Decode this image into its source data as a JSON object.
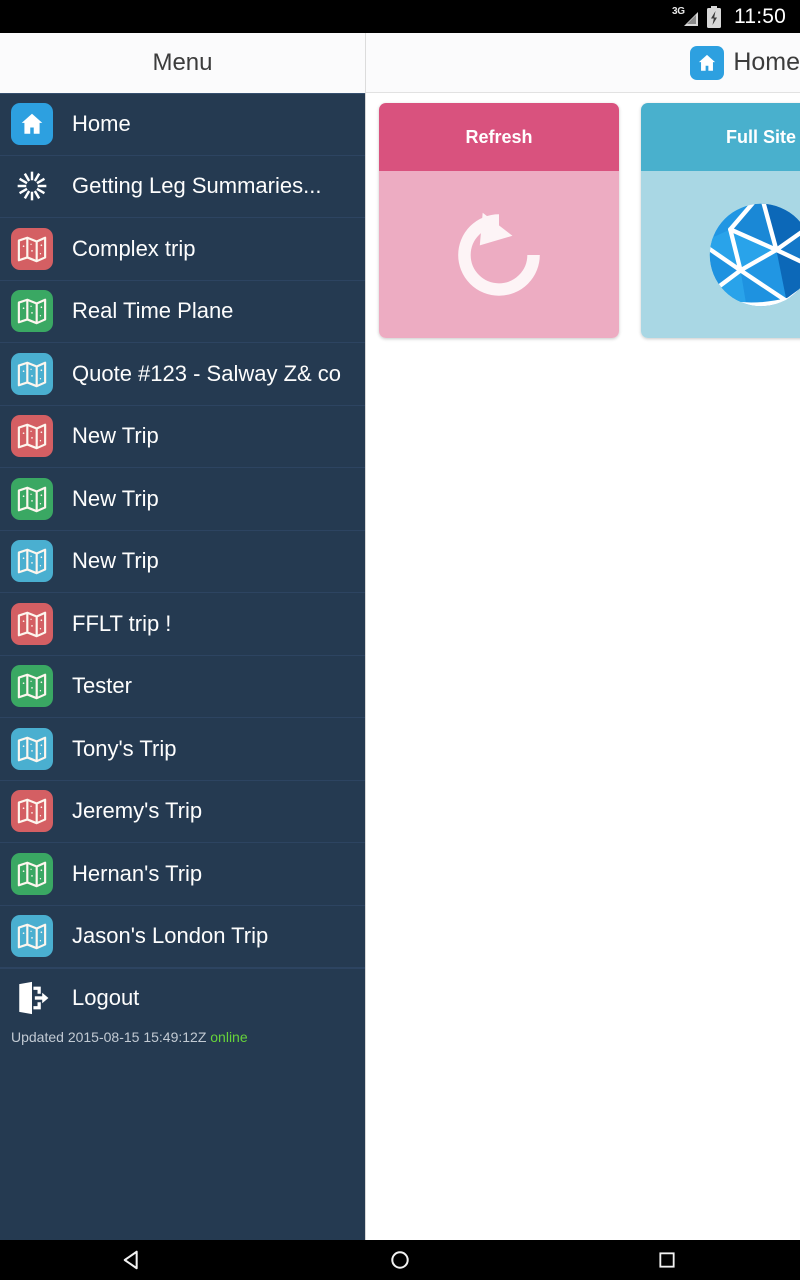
{
  "status_bar": {
    "network": "3G",
    "battery_icon": "battery-charging-icon",
    "time": "11:50"
  },
  "sidebar": {
    "header_title": "Menu",
    "background_color": "#253a51",
    "items": [
      {
        "label": "Home",
        "icon": "home-icon",
        "icon_color": "#2da0e0"
      },
      {
        "label": "Getting Leg Summaries...",
        "icon": "spinner-icon",
        "icon_color": ""
      },
      {
        "label": "Complex trip",
        "icon": "map-icon",
        "icon_color": "#d45f63"
      },
      {
        "label": "Real Time Plane",
        "icon": "map-icon",
        "icon_color": "#3aa863"
      },
      {
        "label": "Quote #123 - Salway Z& co",
        "icon": "map-icon",
        "icon_color": "#4aafd0"
      },
      {
        "label": "New Trip",
        "icon": "map-icon",
        "icon_color": "#d45f63"
      },
      {
        "label": "New Trip",
        "icon": "map-icon",
        "icon_color": "#3aa863"
      },
      {
        "label": "New Trip",
        "icon": "map-icon",
        "icon_color": "#4aafd0"
      },
      {
        "label": "FFLT trip !",
        "icon": "map-icon",
        "icon_color": "#d45f63"
      },
      {
        "label": "Tester",
        "icon": "map-icon",
        "icon_color": "#3aa863"
      },
      {
        "label": "Tony's Trip",
        "icon": "map-icon",
        "icon_color": "#4aafd0"
      },
      {
        "label": "Jeremy's Trip",
        "icon": "map-icon",
        "icon_color": "#d45f63"
      },
      {
        "label": "Hernan's Trip",
        "icon": "map-icon",
        "icon_color": "#3aa863"
      },
      {
        "label": "Jason's London Trip",
        "icon": "map-icon",
        "icon_color": "#4aafd0"
      }
    ],
    "logout": {
      "label": "Logout",
      "icon": "logout-icon"
    },
    "status": {
      "updated_text": "Updated 2015-08-15 15:49:12Z",
      "connection": "online",
      "connection_color": "#66d33a"
    }
  },
  "header": {
    "title": "Home",
    "icon": "home-icon",
    "icon_color": "#2da0e0"
  },
  "main": {
    "cards": [
      {
        "title": "Refresh",
        "icon": "refresh-icon",
        "header_color": "#d9527e",
        "body_color": "#edacc2"
      },
      {
        "title": "Full Site",
        "icon": "globe-icon",
        "header_color": "#49b0cd",
        "body_color": "#a9d7e4"
      }
    ]
  },
  "nav_bar": {
    "buttons": [
      {
        "name": "back",
        "icon": "triangle-back-icon"
      },
      {
        "name": "home",
        "icon": "circle-home-icon"
      },
      {
        "name": "recents",
        "icon": "square-recents-icon"
      }
    ]
  }
}
